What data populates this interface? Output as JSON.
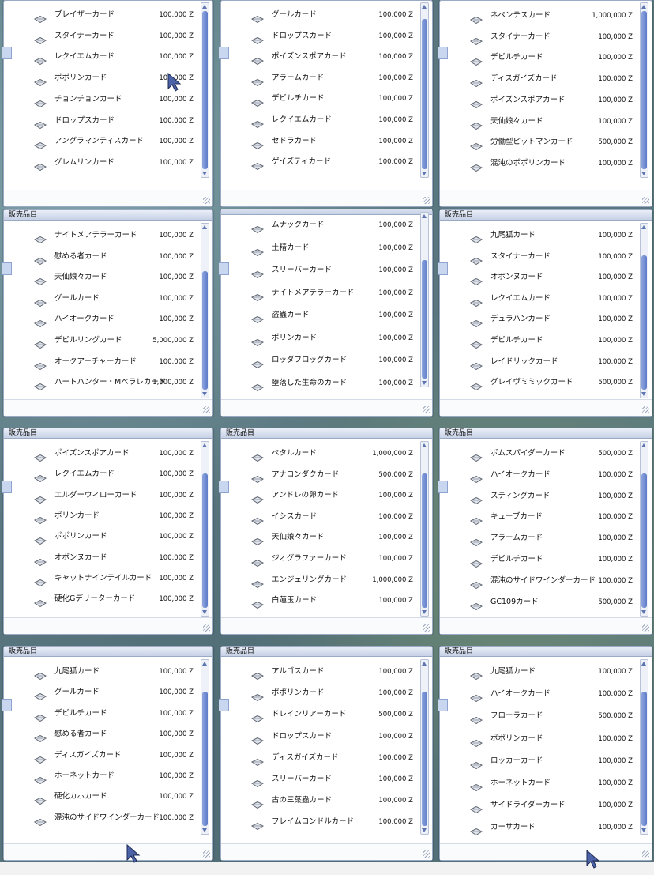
{
  "shop_title": "販売品目",
  "windows": [
    {
      "title": "",
      "rows": [
        {
          "name": "ブレイザーカード",
          "price": "100,000 Z"
        },
        {
          "name": "スタイナーカード",
          "price": "100,000 Z"
        },
        {
          "name": "レクイエムカード",
          "price": "100,000 Z"
        },
        {
          "name": "ポポリンカード",
          "price": "100,000 Z"
        },
        {
          "name": "チョンチョンカード",
          "price": "100,000 Z"
        },
        {
          "name": "ドロップスカード",
          "price": "100,000 Z"
        },
        {
          "name": "アングラマンティスカード",
          "price": "100,000 Z"
        },
        {
          "name": "グレムリンカード",
          "price": "100,000 Z"
        }
      ]
    },
    {
      "title": "",
      "rows": [
        {
          "name": "グールカード",
          "price": "100,000 Z"
        },
        {
          "name": "ドロップスカード",
          "price": "100,000 Z"
        },
        {
          "name": "ポイズンスポアカード",
          "price": "100,000 Z"
        },
        {
          "name": "アラームカード",
          "price": "100,000 Z"
        },
        {
          "name": "デビルチカード",
          "price": "100,000 Z"
        },
        {
          "name": "レクイエムカード",
          "price": "100,000 Z"
        },
        {
          "name": "セドラカード",
          "price": "100,000 Z"
        },
        {
          "name": "ゲイズティカード",
          "price": "100,000 Z"
        }
      ]
    },
    {
      "title": "",
      "rows": [
        {
          "name": "ネペンテスカード",
          "price": "1,000,000 Z"
        },
        {
          "name": "スタイナーカード",
          "price": "100,000 Z"
        },
        {
          "name": "デビルチカード",
          "price": "100,000 Z"
        },
        {
          "name": "ディスガイズカード",
          "price": "100,000 Z"
        },
        {
          "name": "ポイズンスポアカード",
          "price": "100,000 Z"
        },
        {
          "name": "天仙娘々カード",
          "price": "100,000 Z"
        },
        {
          "name": "労働型ピットマンカード",
          "price": "500,000 Z"
        },
        {
          "name": "混沌のポポリンカード",
          "price": "100,000 Z"
        }
      ]
    },
    {
      "title": "販売品目",
      "rows": [
        {
          "name": "ナイトメアテラーカード",
          "price": "100,000 Z"
        },
        {
          "name": "慰める者カード",
          "price": "100,000 Z"
        },
        {
          "name": "天仙娘々カード",
          "price": "100,000 Z"
        },
        {
          "name": "グールカード",
          "price": "100,000 Z"
        },
        {
          "name": "ハイオークカード",
          "price": "100,000 Z"
        },
        {
          "name": "デビルリングカード",
          "price": "5,000,000 Z"
        },
        {
          "name": "オークアーチャーカード",
          "price": "100,000 Z"
        },
        {
          "name": "ハートハンター・Mベラレカード",
          "price": "1,000,000 Z"
        }
      ]
    },
    {
      "title": "",
      "rows": [
        {
          "name": "ムナックカード",
          "price": "100,000 Z"
        },
        {
          "name": "土精カード",
          "price": "100,000 Z"
        },
        {
          "name": "スリーパーカード",
          "price": "100,000 Z"
        },
        {
          "name": "ナイトメアテラーカード",
          "price": "100,000 Z"
        },
        {
          "name": "盗蟲カード",
          "price": "100,000 Z"
        },
        {
          "name": "ポリンカード",
          "price": "100,000 Z"
        },
        {
          "name": "ロッダフロッグカード",
          "price": "100,000 Z"
        },
        {
          "name": "堕落した生命のカード",
          "price": "100,000 Z"
        }
      ]
    },
    {
      "title": "販売品目",
      "rows": [
        {
          "name": "九尾狐カード",
          "price": "100,000 Z"
        },
        {
          "name": "スタイナーカード",
          "price": "100,000 Z"
        },
        {
          "name": "オボンヌカード",
          "price": "100,000 Z"
        },
        {
          "name": "レクイエムカード",
          "price": "100,000 Z"
        },
        {
          "name": "デュラハンカード",
          "price": "100,000 Z"
        },
        {
          "name": "デビルチカード",
          "price": "100,000 Z"
        },
        {
          "name": "レイドリックカード",
          "price": "100,000 Z"
        },
        {
          "name": "グレイヴミミックカード",
          "price": "500,000 Z"
        }
      ]
    },
    {
      "title": "販売品目",
      "rows": [
        {
          "name": "ポイズンスポアカード",
          "price": "100,000 Z"
        },
        {
          "name": "レクイエムカード",
          "price": "100,000 Z"
        },
        {
          "name": "エルダーウィローカード",
          "price": "100,000 Z"
        },
        {
          "name": "ポリンカード",
          "price": "100,000 Z"
        },
        {
          "name": "ポポリンカード",
          "price": "100,000 Z"
        },
        {
          "name": "オボンヌカード",
          "price": "100,000 Z"
        },
        {
          "name": "キャットナインテイルカード",
          "price": "100,000 Z"
        },
        {
          "name": "硬化Gデリーターカード",
          "price": "100,000 Z"
        }
      ]
    },
    {
      "title": "販売品目",
      "rows": [
        {
          "name": "ペタルカード",
          "price": "1,000,000 Z"
        },
        {
          "name": "アナコンダクカード",
          "price": "500,000 Z"
        },
        {
          "name": "アンドレの卵カード",
          "price": "100,000 Z"
        },
        {
          "name": "イシスカード",
          "price": "100,000 Z"
        },
        {
          "name": "天仙娘々カード",
          "price": "100,000 Z"
        },
        {
          "name": "ジオグラファーカード",
          "price": "100,000 Z"
        },
        {
          "name": "エンジェリングカード",
          "price": "1,000,000 Z"
        },
        {
          "name": "白蓮玉カード",
          "price": "100,000 Z"
        }
      ]
    },
    {
      "title": "販売品目",
      "rows": [
        {
          "name": "ボムスパイダーカード",
          "price": "500,000 Z"
        },
        {
          "name": "ハイオークカード",
          "price": "100,000 Z"
        },
        {
          "name": "スティングカード",
          "price": "100,000 Z"
        },
        {
          "name": "キューブカード",
          "price": "100,000 Z"
        },
        {
          "name": "アラームカード",
          "price": "100,000 Z"
        },
        {
          "name": "デビルチカード",
          "price": "100,000 Z"
        },
        {
          "name": "混沌のサイドワインダーカード",
          "price": "100,000 Z"
        },
        {
          "name": "GC109カード",
          "price": "500,000 Z"
        }
      ]
    },
    {
      "title": "販売品目",
      "rows": [
        {
          "name": "九尾狐カード",
          "price": "100,000 Z"
        },
        {
          "name": "グールカード",
          "price": "100,000 Z"
        },
        {
          "name": "デビルチカード",
          "price": "100,000 Z"
        },
        {
          "name": "慰める者カード",
          "price": "100,000 Z"
        },
        {
          "name": "ディスガイズカード",
          "price": "100,000 Z"
        },
        {
          "name": "ホーネットカード",
          "price": "100,000 Z"
        },
        {
          "name": "硬化カホカード",
          "price": "100,000 Z"
        },
        {
          "name": "混沌のサイドワインダーカード",
          "price": "100,000 Z"
        }
      ]
    },
    {
      "title": "販売品目",
      "rows": [
        {
          "name": "アルゴスカード",
          "price": "100,000 Z"
        },
        {
          "name": "ポポリンカード",
          "price": "100,000 Z"
        },
        {
          "name": "ドレインリアーカード",
          "price": "500,000 Z"
        },
        {
          "name": "ドロップスカード",
          "price": "100,000 Z"
        },
        {
          "name": "ディスガイズカード",
          "price": "100,000 Z"
        },
        {
          "name": "スリーパーカード",
          "price": "100,000 Z"
        },
        {
          "name": "古の三葉蟲カード",
          "price": "100,000 Z"
        },
        {
          "name": "フレイムコンドルカード",
          "price": "100,000 Z"
        }
      ]
    },
    {
      "title": "販売品目",
      "rows": [
        {
          "name": "九尾狐カード",
          "price": "100,000 Z"
        },
        {
          "name": "ハイオークカード",
          "price": "100,000 Z"
        },
        {
          "name": "フローラカード",
          "price": "500,000 Z"
        },
        {
          "name": "ポポリンカード",
          "price": "100,000 Z"
        },
        {
          "name": "ロッカーカード",
          "price": "100,000 Z"
        },
        {
          "name": "ホーネットカード",
          "price": "100,000 Z"
        },
        {
          "name": "サイドライダーカード",
          "price": "100,000 Z"
        },
        {
          "name": "カーサカード",
          "price": "100,000 Z"
        }
      ]
    }
  ]
}
